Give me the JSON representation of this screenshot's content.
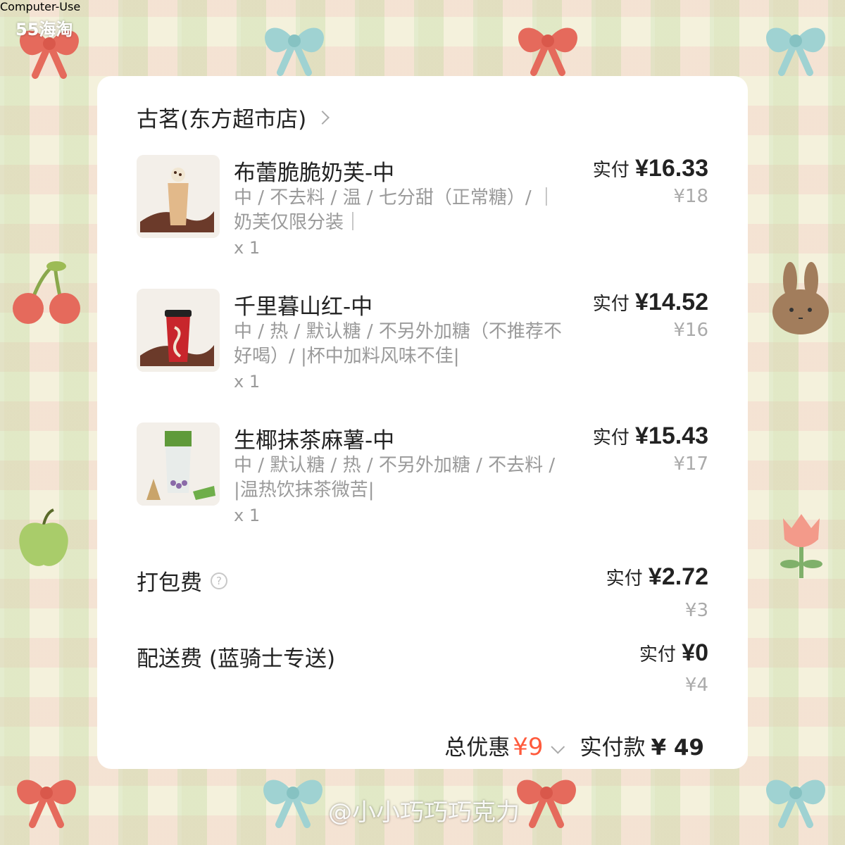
{
  "watermark": "55海淘",
  "credit": "@小小巧巧巧克力",
  "shop": {
    "name": "古茗(东方超市店)"
  },
  "items": [
    {
      "name": "布蕾脆脆奶芙-中",
      "spec": "中 / 不去料 / 温 / 七分甜（正常糖）/ ｜奶芙仅限分装｜",
      "qty": "x 1",
      "paid_label": "实付",
      "paid_value": "¥16.33",
      "original": "¥18"
    },
    {
      "name": "千里暮山红-中",
      "spec": "中 / 热 / 默认糖 / 不另外加糖（不推荐不好喝）/ |杯中加料风味不佳|",
      "qty": "x 1",
      "paid_label": "实付",
      "paid_value": "¥14.52",
      "original": "¥16"
    },
    {
      "name": "生椰抹茶麻薯-中",
      "spec": "中 / 默认糖 / 热 / 不另外加糖 / 不去料 / |温热饮抹茶微苦|",
      "qty": "x 1",
      "paid_label": "实付",
      "paid_value": "¥15.43",
      "original": "¥17"
    }
  ],
  "fees": [
    {
      "name": "打包费",
      "paid_label": "实付",
      "paid_value": "¥2.72",
      "original": "¥3",
      "has_help_icon": true
    },
    {
      "name": "配送费 (蓝骑士专送)",
      "paid_label": "实付",
      "paid_value": "¥0",
      "original": "¥4"
    }
  ],
  "summary": {
    "discount_label": "总优惠",
    "discount_value": "¥9",
    "pay_label": "实付款",
    "pay_value": "¥ 49"
  },
  "colors": {
    "accent_discount": "#ff5a3c",
    "text_primary": "#222222",
    "text_secondary": "#9a9a9a"
  }
}
